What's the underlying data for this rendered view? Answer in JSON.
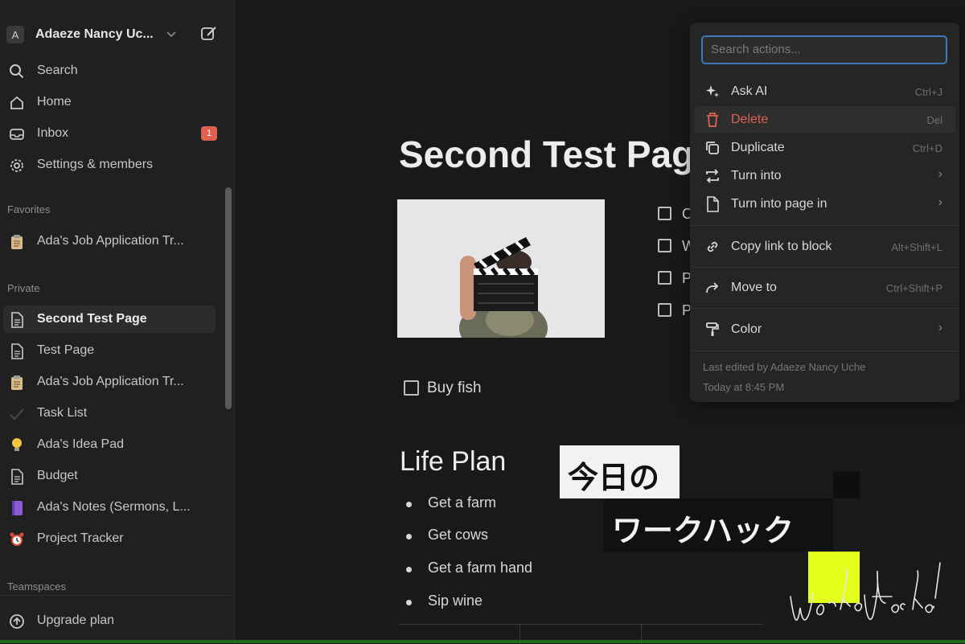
{
  "workspace": {
    "avatar_letter": "A",
    "name": "Adaeze Nancy Uc..."
  },
  "nav": [
    {
      "label": "Search",
      "icon": "search-icon"
    },
    {
      "label": "Home",
      "icon": "home-icon"
    },
    {
      "label": "Inbox",
      "icon": "inbox-icon",
      "badge": "1"
    },
    {
      "label": "Settings & members",
      "icon": "gear-icon"
    }
  ],
  "sections": {
    "favorites": "Favorites",
    "private": "Private",
    "teamspaces": "Teamspaces"
  },
  "favorites": [
    {
      "label": "Ada's Job Application Tr...",
      "icon": "clipboard-icon"
    }
  ],
  "private": [
    {
      "label": "Second Test Page",
      "icon": "page-icon",
      "selected": true
    },
    {
      "label": "Test Page",
      "icon": "page-icon"
    },
    {
      "label": "Ada's Job Application Tr...",
      "icon": "clipboard-icon"
    },
    {
      "label": "Task List",
      "icon": "checkmark-icon"
    },
    {
      "label": "Ada's Idea Pad",
      "icon": "lightbulb-icon"
    },
    {
      "label": "Budget",
      "icon": "page-icon"
    },
    {
      "label": "Ada's Notes (Sermons, L...",
      "icon": "notebook-icon"
    },
    {
      "label": "Project Tracker",
      "icon": "alarm-clock-icon"
    }
  ],
  "upgrade": {
    "label": "Upgrade plan",
    "icon": "upgrade-icon"
  },
  "page": {
    "title": "Second Test Page",
    "todos_right": [
      "C",
      "W",
      "P",
      "P"
    ],
    "todo_main": "Buy fish",
    "heading": "Life Plan",
    "bullets": [
      "Get a farm",
      "Get cows",
      "Get a farm hand",
      "Sip wine"
    ]
  },
  "menu": {
    "search_placeholder": "Search actions...",
    "items": [
      {
        "label": "Ask AI",
        "shortcut": "Ctrl+J",
        "icon": "sparkle-icon"
      },
      {
        "label": "Delete",
        "shortcut": "Del",
        "icon": "trash-icon"
      },
      {
        "label": "Duplicate",
        "shortcut": "Ctrl+D",
        "icon": "duplicate-icon"
      },
      {
        "label": "Turn into",
        "icon": "turn-into-icon"
      },
      {
        "label": "Turn into page in",
        "icon": "page-icon"
      },
      {
        "label": "Copy link to block",
        "shortcut": "Alt+Shift+L",
        "icon": "link-icon"
      },
      {
        "label": "Move to",
        "shortcut": "Ctrl+Shift+P",
        "icon": "move-arrow-icon"
      },
      {
        "label": "Color",
        "icon": "paint-roller-icon"
      }
    ],
    "last_edited_by": "Last edited by Adaeze Nancy Uche",
    "last_edited_time": "Today at 8:45 PM"
  },
  "overlay": {
    "line1": "今日の",
    "line2": "ワークハック",
    "signature": "WorkHack!"
  },
  "colors": {
    "accent_blue": "#3f7ab8",
    "danger": "#e0604f",
    "highlight_yellow": "#e3ff1a"
  }
}
